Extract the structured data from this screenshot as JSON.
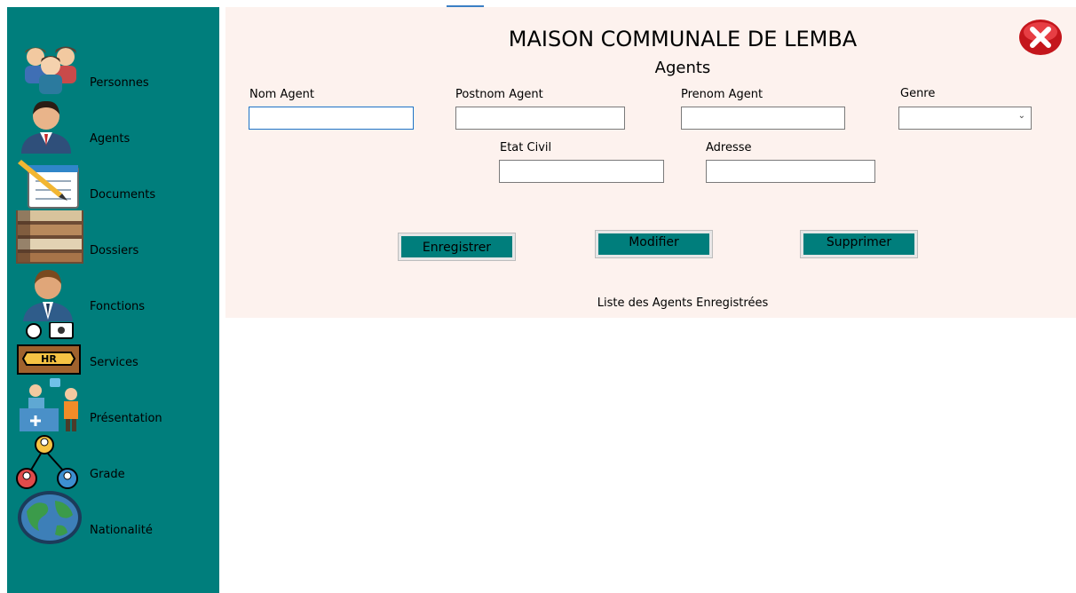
{
  "header": {
    "title": "MAISON COMMUNALE DE LEMBA",
    "subtitle": "Agents"
  },
  "sidebar": {
    "items": [
      {
        "label": "Personnes",
        "icon": "people-group-icon"
      },
      {
        "label": "Agents",
        "icon": "agent-person-icon"
      },
      {
        "label": "Documents",
        "icon": "notepad-pencil-icon"
      },
      {
        "label": "Dossiers",
        "icon": "bookshelf-icon"
      },
      {
        "label": "Fonctions",
        "icon": "employee-tie-icon"
      },
      {
        "label": "Services",
        "icon": "hr-desk-icon"
      },
      {
        "label": "Présentation",
        "icon": "reception-desk-icon"
      },
      {
        "label": "Grade",
        "icon": "hierarchy-users-icon"
      },
      {
        "label": "Nationalité",
        "icon": "globe-icon"
      }
    ]
  },
  "form": {
    "nom_label": "Nom Agent",
    "nom_value": "",
    "postnom_label": "Postnom Agent",
    "postnom_value": "",
    "prenom_label": "Prenom Agent",
    "prenom_value": "",
    "genre_label": "Genre",
    "genre_value": "",
    "etat_civil_label": "Etat Civil",
    "etat_civil_value": "",
    "adresse_label": "Adresse",
    "adresse_value": ""
  },
  "actions": {
    "save_label": "Enregistrer",
    "edit_label": "Modifier",
    "delete_label": "Supprimer"
  },
  "list": {
    "title": "Liste des Agents Enregistrées"
  },
  "colors": {
    "sidebar": "#007e7c",
    "header_bg": "#fdf2ee",
    "button_face": "#007e7c",
    "close": "#d7141b"
  }
}
